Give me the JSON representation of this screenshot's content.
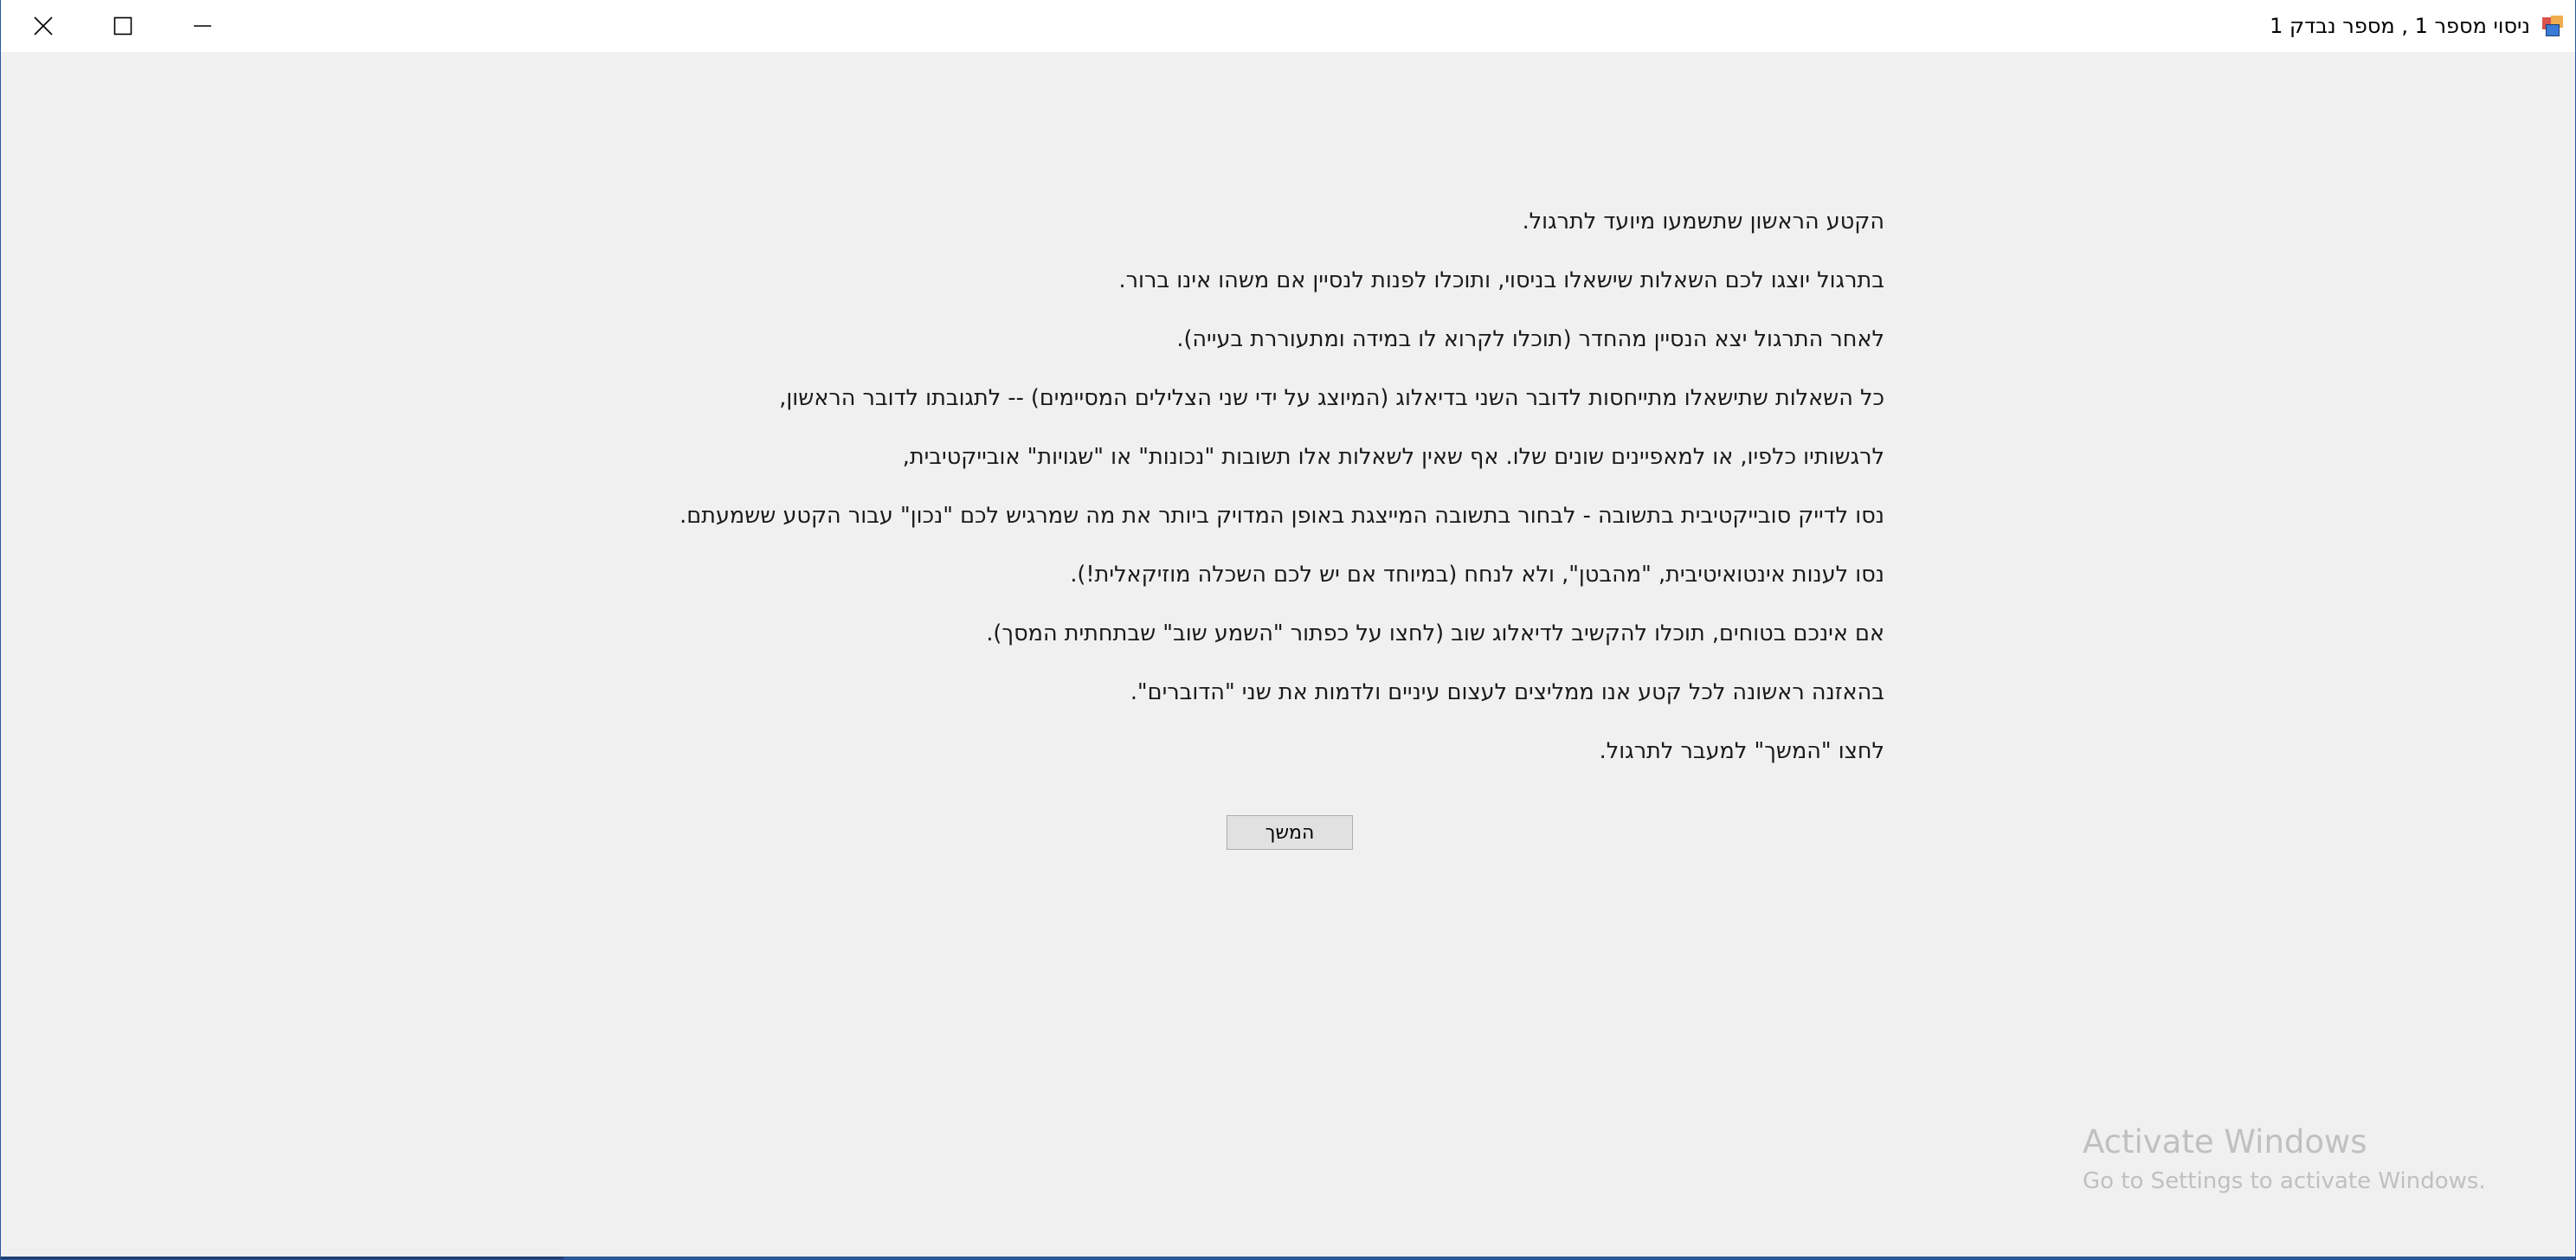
{
  "window": {
    "title": "ניסוי מספר 1 , מספר נבדק 1",
    "app_icon": "app-window-icon",
    "controls": {
      "close_icon": "close-icon",
      "maximize_icon": "maximize-icon",
      "minimize_icon": "minimize-icon"
    }
  },
  "instructions": {
    "lines": [
      "הקטע הראשון שתשמעו מיועד לתרגול.",
      "בתרגול יוצגו לכם השאלות שישאלו בניסוי, ותוכלו לפנות לנסיין אם משהו אינו ברור.",
      "לאחר התרגול יצא הנסיין מהחדר (תוכלו לקרוא לו במידה ומתעוררת בעייה).",
      "כל השאלות שתישאלו מתייחסות לדובר השני בדיאלוג (המיוצג על ידי שני הצלילים המסיימים) -- לתגובתו לדובר הראשון,",
      "לרגשותיו כלפיו, או למאפיינים שונים שלו.  אף שאין לשאלות אלו תשובות \"נכונות\" או \"שגויות\" אובייקטיבית,",
      "נסו לדייק סובייקטיבית בתשובה - לבחור בתשובה המייצגת באופן המדויק ביותר את מה שמרגיש לכם \"נכון\" עבור הקטע ששמעתם.",
      "נסו לענות אינטואיטיבית, \"מהבטן\", ולא לנחח (במיוחד אם יש לכם השכלה מוזיקאלית!).",
      "אם אינכם בטוחים, תוכלו להקשיב לדיאלוג שוב (לחצו על כפתור \"השמע שוב\" שבתחתית המסך).",
      "בהאזנה ראשונה לכל קטע אנו ממליצים לעצום עיניים ולדמות את שני \"הדוברים\".",
      "לחצו \"המשך\" למעבר לתרגול."
    ]
  },
  "continue_button": {
    "label": "המשך"
  },
  "watermark": {
    "title": "Activate Windows",
    "subtitle": "Go to Settings to activate Windows."
  },
  "colors": {
    "window_border": "#2b5797",
    "background": "#f0f0f0",
    "titlebar": "#ffffff",
    "button_face": "#e1e1e1",
    "button_border": "#adadad",
    "watermark_text": "#c0c0c0"
  }
}
